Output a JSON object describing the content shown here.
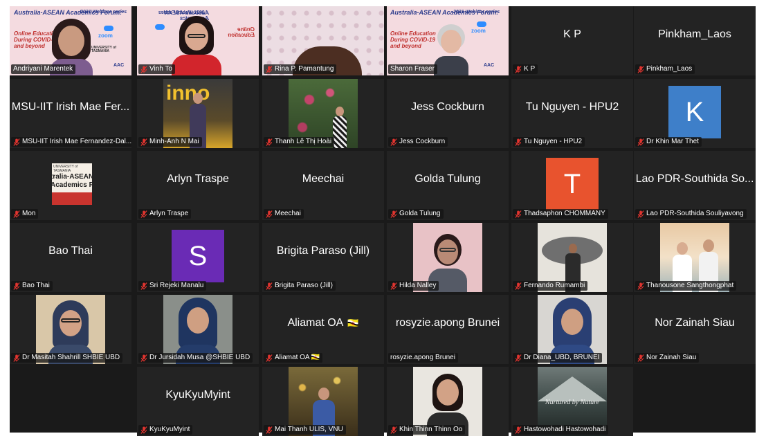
{
  "banner": {
    "title": "Australia-ASEAN Academics Forum:",
    "series": "2021 Webinar series",
    "subtitle_lines": [
      "Online Education",
      "During COVID-19",
      "and beyond"
    ],
    "zoom": "zoom",
    "university": "UNIVERSITY of TASMANIA",
    "aac": "AAC"
  },
  "mon_card": {
    "lines": [
      "tralia-ASEAN",
      "Academics Forum"
    ],
    "university": "UNIVERSITY of TASMANIA"
  },
  "hastowohadi_card": {
    "title": "Nurtured by Nature"
  },
  "colors": {
    "speaking_outline": "#c9d94a",
    "mute_icon": "#e0342f",
    "tile_bg": "#232323",
    "gallery_bg": "#1a1a1a"
  },
  "participants": {
    "r0c0": {
      "nameplate": "Andriyani Marentek",
      "muted": false
    },
    "r0c1": {
      "nameplate": "Vinh To",
      "muted": true
    },
    "r0c2": {
      "nameplate": "Rina P.  Pamantung",
      "muted": true
    },
    "r0c3": {
      "nameplate": "Sharon Fraser",
      "muted": false
    },
    "r0c4": {
      "display": "K P",
      "nameplate": "K P",
      "muted": true
    },
    "r0c5": {
      "display": "Pinkham_Laos",
      "nameplate": "Pinkham_Laos",
      "muted": true
    },
    "r1c0": {
      "display": "MSU-IIT Irish Mae Fer...",
      "nameplate": "MSU-IIT Irish Mae Fernandez-Dal...",
      "muted": true
    },
    "r1c1": {
      "nameplate": "Minh-Anh N Mai",
      "muted": true
    },
    "r1c2": {
      "nameplate": "Thanh Lê Thị Hoài",
      "muted": true
    },
    "r1c3": {
      "display": "Jess Cockburn",
      "nameplate": "Jess Cockburn",
      "muted": true
    },
    "r1c4": {
      "display": "Tu Nguyen - HPU2",
      "nameplate": "Tu Nguyen - HPU2",
      "muted": true
    },
    "r1c5": {
      "avatar": "K",
      "avatar_color": "#3e7fc9",
      "nameplate": "Dr Khin Mar Thet",
      "muted": true
    },
    "r2c0": {
      "nameplate": "Mon",
      "muted": true
    },
    "r2c1": {
      "display": "Arlyn Traspe",
      "nameplate": "Arlyn Traspe",
      "muted": true
    },
    "r2c2": {
      "display": "Meechai",
      "nameplate": "Meechai",
      "muted": true
    },
    "r2c3": {
      "display": "Golda Tulung",
      "nameplate": "Golda Tulung",
      "muted": true
    },
    "r2c4": {
      "avatar": "T",
      "avatar_color": "#e8532e",
      "nameplate": "Thadsaphon CHOMMANY",
      "muted": true
    },
    "r2c5": {
      "display": "Lao PDR-Southida So...",
      "nameplate": "Lao PDR-Southida Souliyavong",
      "muted": true
    },
    "r3c0": {
      "display": "Bao Thai",
      "nameplate": "Bao Thai",
      "muted": true
    },
    "r3c1": {
      "avatar": "S",
      "avatar_color": "#6a2bb5",
      "nameplate": "Sri Rejeki Manalu",
      "muted": true
    },
    "r3c2": {
      "display": "Brigita Paraso (Jill)",
      "nameplate": "Brigita Paraso (Jill)",
      "muted": true
    },
    "r3c3": {
      "nameplate": "Hilda Nalley",
      "muted": true
    },
    "r3c4": {
      "nameplate": "Fernando Rumambi",
      "muted": true
    },
    "r3c5": {
      "nameplate": "Thanousone Sangthongphat",
      "muted": true
    },
    "r4c0": {
      "nameplate": "Dr Masitah Shahrill SHBIE UBD",
      "muted": true
    },
    "r4c1": {
      "nameplate": "Dr Jursidah Musa @SHBIE UBD",
      "muted": true
    },
    "r4c2": {
      "display": "Aliamat OA",
      "display_flag": "🇧🇳",
      "nameplate": "Aliamat OA 🇧🇳",
      "muted": true
    },
    "r4c3": {
      "display": "rosyzie.apong Brunei",
      "nameplate": "rosyzie.apong Brunei",
      "muted": false
    },
    "r4c4": {
      "nameplate": "Dr Diana_UBD, BRUNEI",
      "muted": true
    },
    "r4c5": {
      "display": "Nor Zainah Siau",
      "nameplate": "Nor Zainah Siau",
      "muted": true
    },
    "r5c1": {
      "display": "KyuKyuMyint",
      "nameplate": "KyuKyuMyint",
      "muted": true
    },
    "r5c2": {
      "nameplate": "Mai Thanh ULIS, VNU",
      "muted": true
    },
    "r5c3": {
      "nameplate": "Khin Thinn Thinn Oo",
      "muted": true
    },
    "r5c4": {
      "nameplate": "Hastowohadi Hastowohadi",
      "muted": true
    }
  }
}
